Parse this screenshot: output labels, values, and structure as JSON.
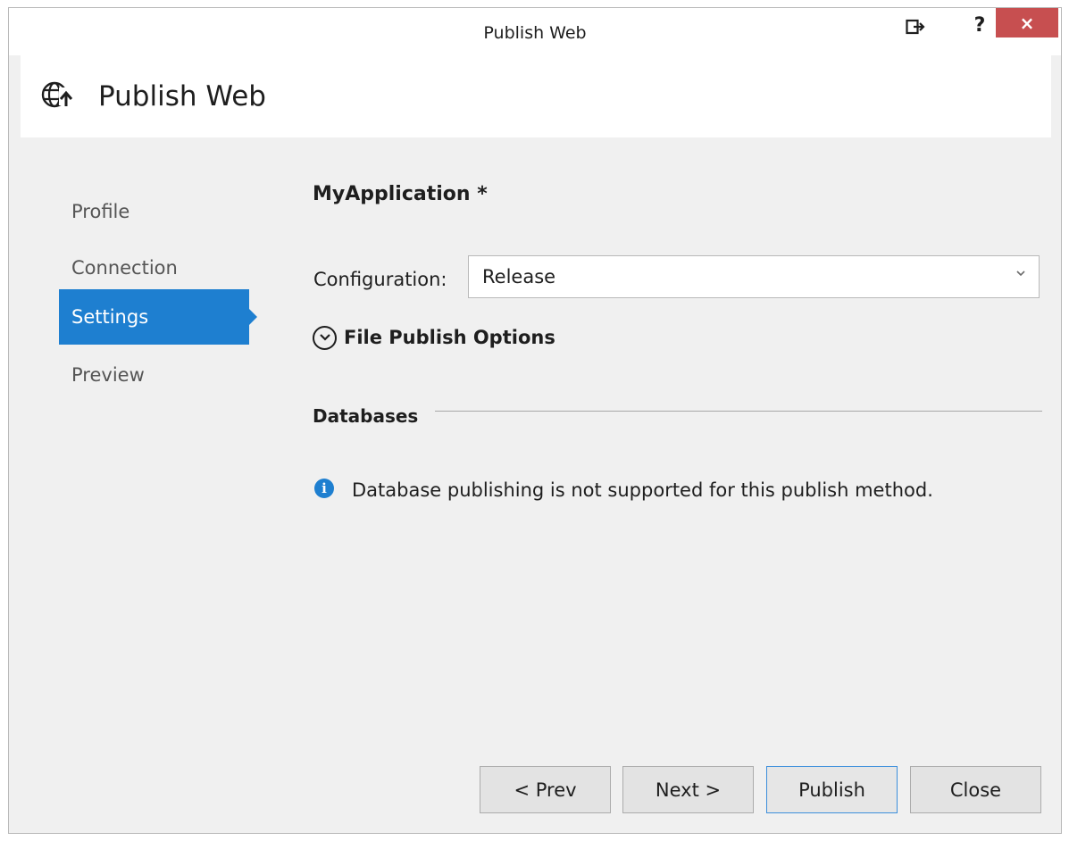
{
  "window": {
    "title": "Publish Web",
    "close_glyph": "×",
    "help_glyph": "?",
    "feedback_icon": "feedback-icon"
  },
  "header": {
    "title": "Publish Web",
    "logo_icon": "globe-publish-icon"
  },
  "nav": {
    "items": [
      {
        "label": "Profile",
        "active": false
      },
      {
        "label": "Connection",
        "active": false
      },
      {
        "label": "Settings",
        "active": true
      },
      {
        "label": "Preview",
        "active": false
      }
    ]
  },
  "settings": {
    "app_name": "MyApplication *",
    "configuration_label": "Configuration:",
    "configuration_value": "Release",
    "file_publish_options_label": "File Publish Options",
    "databases_title": "Databases",
    "info_message": "Database publishing is not supported for this publish method."
  },
  "buttons": {
    "prev": "< Prev",
    "next": "Next >",
    "publish": "Publish",
    "close": "Close"
  },
  "colors": {
    "accent": "#1e7fd0",
    "close_button": "#c74f50",
    "background": "#f0f0f0"
  }
}
